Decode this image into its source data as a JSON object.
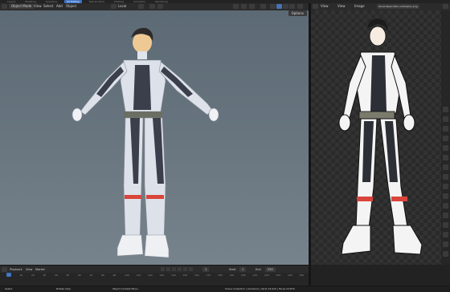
{
  "top_tabs": [
    "Layout",
    "Modeling",
    "Sculpting",
    "UV Editing",
    "Texture Paint",
    "Shading",
    "Animation",
    "Rendering"
  ],
  "active_tab_index": 3,
  "viewport_header": {
    "mode": "Object Mode",
    "menus": [
      "View",
      "Select",
      "Add",
      "Object"
    ],
    "orientation": "Local",
    "options_label": "Options"
  },
  "image_editor_header": {
    "menus": [
      "View",
      "View",
      "Image"
    ],
    "image_name": "Ghost-Newcuttin-outlinebox.png"
  },
  "timeline": {
    "menus": [
      "Playback",
      "View",
      "Marker"
    ],
    "current_frame": "1",
    "start_label": "Start",
    "start_value": "1",
    "end_label": "End",
    "end_value": "250",
    "ticks": [
      "0",
      "10",
      "20",
      "30",
      "40",
      "50",
      "60",
      "70",
      "80",
      "90",
      "100",
      "110",
      "120",
      "130",
      "140",
      "150",
      "160",
      "170",
      "180",
      "190",
      "200",
      "210",
      "220",
      "230",
      "240",
      "250"
    ]
  },
  "status_bar": {
    "left_hint": "Select",
    "middle_hint": "Rotate View",
    "right_hint": "Object Context Menu",
    "info": "Scene Collection | Armature | Verts 24,910 | Faces 23,874"
  },
  "colors": {
    "accent": "#3d74c6",
    "viewport_bg": "#68757f",
    "suit_white": "#dfe4ec",
    "suit_dark": "#3a3f4b",
    "stripe_red": "#d9453b"
  }
}
